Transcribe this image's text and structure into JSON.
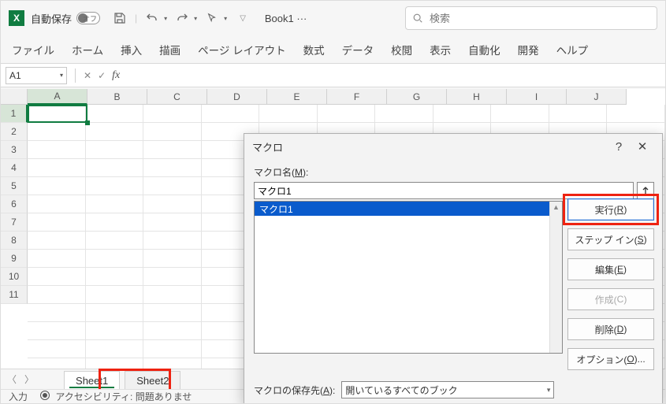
{
  "titlebar": {
    "autosave_label": "自動保存",
    "autosave_state": "オフ",
    "document_title": "Book1  ···",
    "search_placeholder": "検索"
  },
  "ribbon": {
    "tabs": [
      "ファイル",
      "ホーム",
      "挿入",
      "描画",
      "ページ レイアウト",
      "数式",
      "データ",
      "校閲",
      "表示",
      "自動化",
      "開発",
      "ヘルプ"
    ]
  },
  "formula_bar": {
    "namebox_value": "A1"
  },
  "grid": {
    "columns": [
      "A",
      "B",
      "C",
      "D",
      "E",
      "F",
      "G",
      "H",
      "I",
      "J"
    ],
    "rows": [
      "1",
      "2",
      "3",
      "4",
      "5",
      "6",
      "7",
      "8",
      "9",
      "10",
      "11"
    ],
    "active_col": 0,
    "active_row": 0
  },
  "sheets": {
    "tabs": [
      "Sheet1",
      "Sheet2"
    ],
    "active_index": 0
  },
  "status": {
    "mode": "入力",
    "accessibility": "アクセシビリティ: 問題ありませ"
  },
  "dialog": {
    "title": "マクロ",
    "name_label_pre": "マクロ名(",
    "name_label_key": "M",
    "name_label_post": "):",
    "name_value": "マクロ1",
    "list_items": [
      "マクロ1"
    ],
    "selected_index": 0,
    "buttons": {
      "run_pre": "実行(",
      "run_key": "R",
      "run_post": ")",
      "step_pre": "ステップ イン(",
      "step_key": "S",
      "step_post": ")",
      "edit_pre": "編集(",
      "edit_key": "E",
      "edit_post": ")",
      "create_pre": "作成(",
      "create_key": "C",
      "create_post": ")",
      "delete_pre": "削除(",
      "delete_key": "D",
      "delete_post": ")",
      "options_pre": "オプション(",
      "options_key": "O",
      "options_post": ")..."
    },
    "store_label_pre": "マクロの保存先(",
    "store_label_key": "A",
    "store_label_post": "):",
    "store_value": "開いているすべてのブック"
  }
}
